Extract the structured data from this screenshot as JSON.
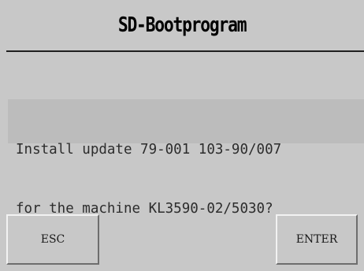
{
  "header": {
    "title": "SD-Bootprogram"
  },
  "dialog": {
    "message_lines": [
      "Install update 79-001 103-90/007",
      "for the machine KL3590-02/5030?"
    ]
  },
  "buttons": {
    "esc_label": "ESC",
    "enter_label": "ENTER"
  }
}
